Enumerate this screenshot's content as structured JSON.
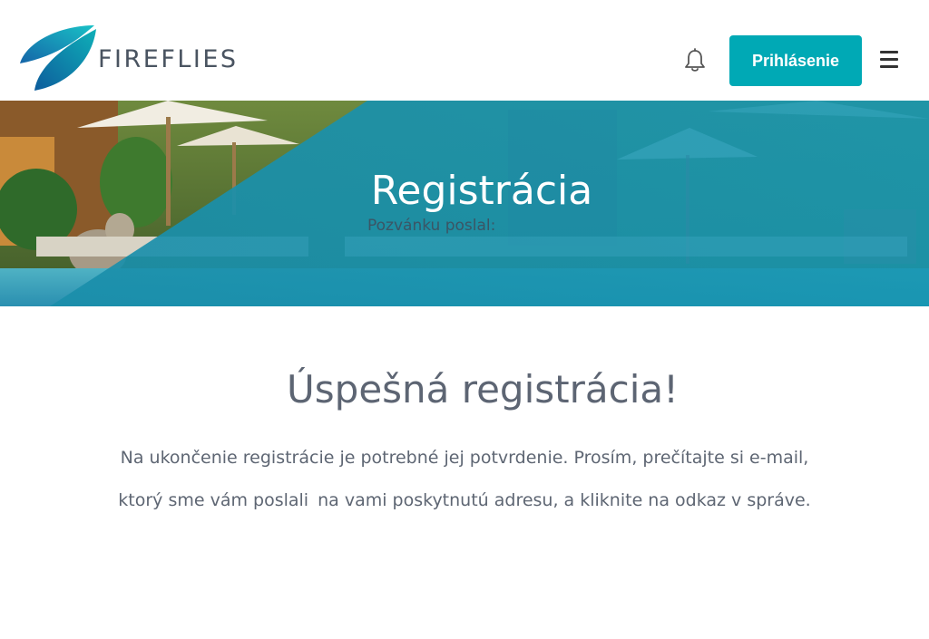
{
  "brand": {
    "name": "FIREFLIES",
    "accent": "#00a9b5"
  },
  "header": {
    "login_label": "Prihlásenie",
    "icons": [
      "bell-icon",
      "hamburger-menu-icon"
    ]
  },
  "hero": {
    "title": "Registrácia",
    "subtitle": "Pozvánku poslal:"
  },
  "content": {
    "success_title": "Úspešná registrácia!",
    "line1": "Na ukončenie registrácie je potrebné jej potvrdenie. Prosím, prečítajte si e-mail,",
    "line2a": "ktorý sme vám poslali",
    "line2b": "na vami poskytnutú adresu, a kliknite na odkaz v správe."
  }
}
